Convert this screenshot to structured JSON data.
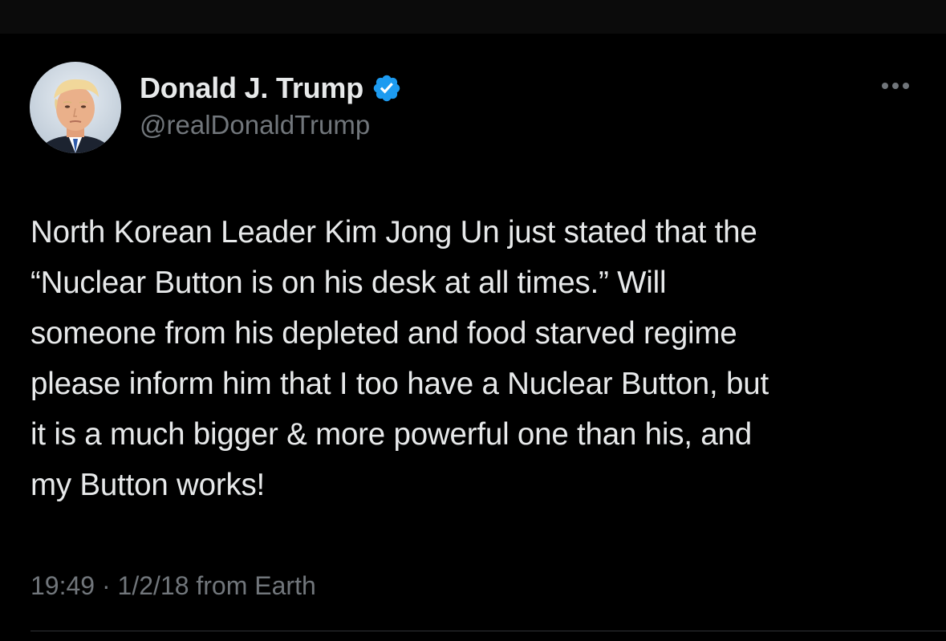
{
  "author": {
    "display_name": "Donald J. Trump",
    "handle": "@realDonaldTrump",
    "verified": true,
    "verified_color": "#1d9bf0"
  },
  "tweet": {
    "lines": [
      "North Korean Leader Kim Jong Un just stated that the",
      "“Nuclear Button is on his desk at all times.” Will",
      "someone from his depleted and food starved regime",
      "please inform him that I too have a Nuclear Button, but",
      "it is a much bigger & more powerful one than his, and",
      "my Button works!"
    ],
    "time": "19:49",
    "separator": "·",
    "date": "1/2/18",
    "source": "from Earth"
  },
  "icons": {
    "verified": "verified-badge-icon",
    "more": "more-options-icon"
  },
  "colors": {
    "background": "#000000",
    "primary_text": "#e7e9ea",
    "secondary_text": "#71767b",
    "divider": "#2f3336"
  }
}
